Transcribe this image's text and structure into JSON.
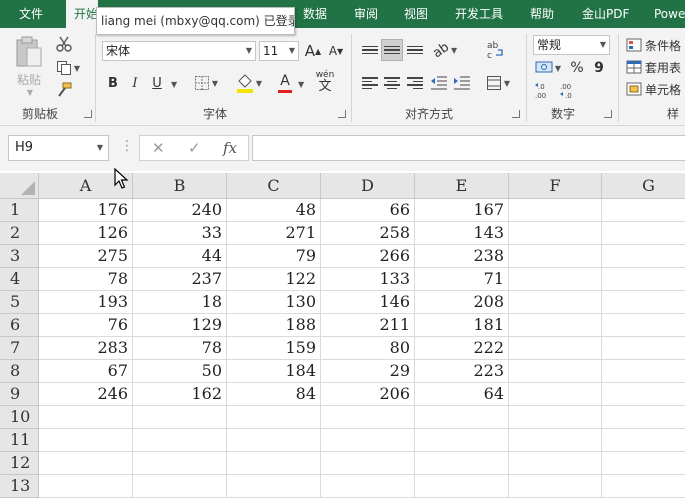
{
  "tabs": [
    "文件",
    "开始",
    "数据",
    "审阅",
    "视图",
    "开发工具",
    "帮助",
    "金山PDF",
    "Powe"
  ],
  "account_tooltip": "liang mei (mbxy@qq.com) 已登录",
  "ribbon": {
    "clipboard": {
      "paste_label": "粘贴",
      "group_label": "剪贴板"
    },
    "font": {
      "font_name": "宋体",
      "font_size": "11",
      "grow_label": "A",
      "shrink_label": "A",
      "bold": "B",
      "italic": "I",
      "underline": "U",
      "font_color_label": "A",
      "phonetic_label": "wén",
      "phonetic_char": "文",
      "group_label": "字体"
    },
    "alignment": {
      "group_label": "对齐方式"
    },
    "number": {
      "format": "常规",
      "percent": "%",
      "comma": "9",
      "group_label": "数字"
    },
    "styles": {
      "conditional_formatting": "条件格",
      "format_as_table": "套用表",
      "cell_styles": "单元格",
      "group_label": "样"
    }
  },
  "formula_bar": {
    "name_box": "H9",
    "cancel_icon": "✕",
    "enter_icon": "✓",
    "fx_label": "fx",
    "formula": ""
  },
  "grid": {
    "columns": [
      "A",
      "B",
      "C",
      "D",
      "E",
      "F",
      "G"
    ],
    "rows": [
      "1",
      "2",
      "3",
      "4",
      "5",
      "6",
      "7",
      "8",
      "9",
      "10",
      "11",
      "12",
      "13"
    ],
    "data": [
      [
        "176",
        "240",
        "48",
        "66",
        "167"
      ],
      [
        "126",
        "33",
        "271",
        "258",
        "143"
      ],
      [
        "275",
        "44",
        "79",
        "266",
        "238"
      ],
      [
        "78",
        "237",
        "122",
        "133",
        "71"
      ],
      [
        "193",
        "18",
        "130",
        "146",
        "208"
      ],
      [
        "76",
        "129",
        "188",
        "211",
        "181"
      ],
      [
        "283",
        "78",
        "159",
        "80",
        "222"
      ],
      [
        "67",
        "50",
        "184",
        "29",
        "223"
      ],
      [
        "246",
        "162",
        "84",
        "206",
        "64"
      ]
    ]
  },
  "colors": {
    "accent": "#217346",
    "ribbon_bg": "#f3f3f3",
    "header_bg": "#e6e6e6",
    "gridline": "#dadada"
  }
}
